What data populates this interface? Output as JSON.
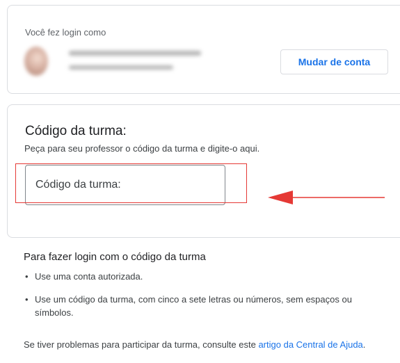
{
  "account": {
    "logged_in_as": "Você fez login como",
    "switch_account": "Mudar de conta"
  },
  "class_code": {
    "title": "Código da turma:",
    "subtitle": "Peça para seu professor o código da turma e digite-o aqui.",
    "input_placeholder": "Código da turma:",
    "input_value": ""
  },
  "help": {
    "title": "Para fazer login com o código da turma",
    "bullets": [
      "Use uma conta autorizada.",
      "Use um código da turma, com cinco a sete letras ou números, sem espaços ou símbolos."
    ],
    "footer_text": "Se tiver problemas para participar da turma, consulte este ",
    "footer_link": "artigo da Central de Ajuda",
    "footer_end": "."
  },
  "colors": {
    "accent": "#1a73e8",
    "annotation": "#e53935",
    "border": "#dadce0"
  }
}
